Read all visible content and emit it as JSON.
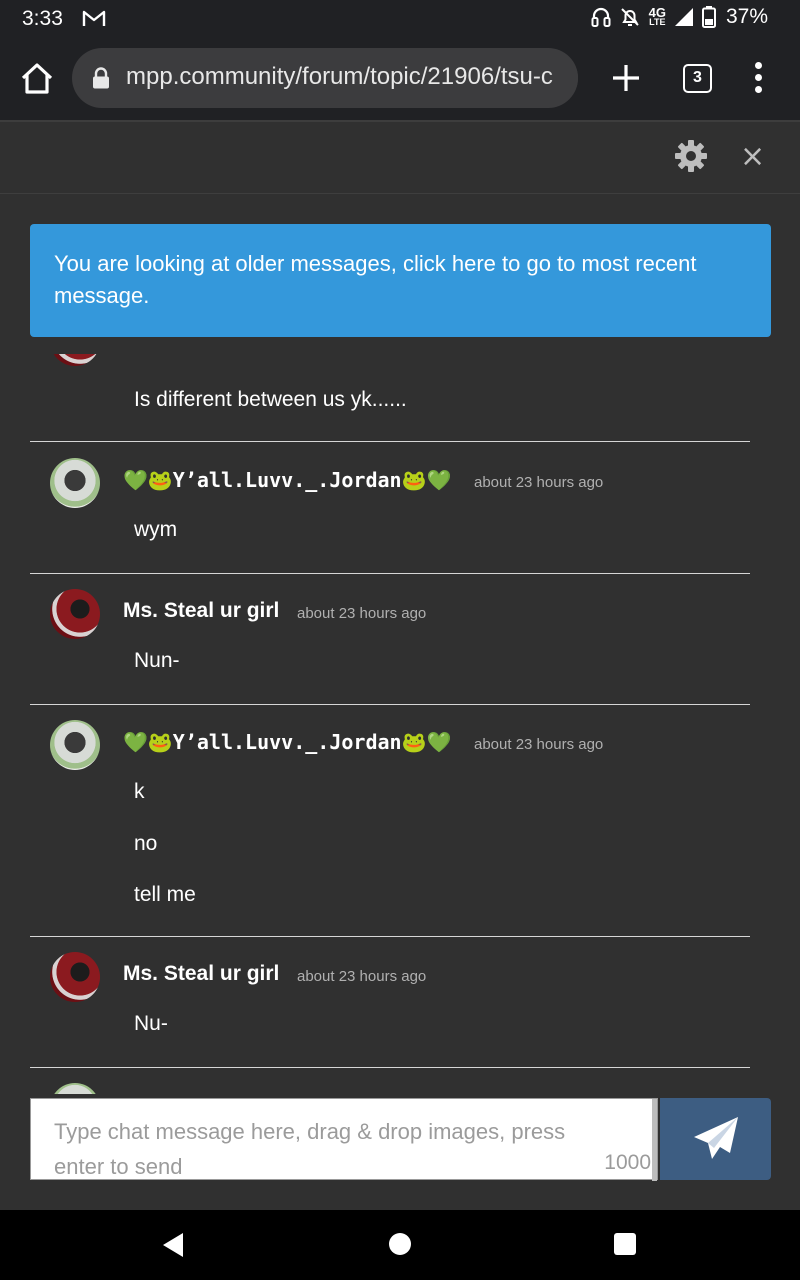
{
  "status_bar": {
    "time": "3:33",
    "network": "4G",
    "network_sub": "LTE",
    "battery": "37%",
    "icons": [
      "gmail-icon",
      "headphones-icon",
      "bell-off-icon",
      "signal-icon",
      "battery-icon"
    ]
  },
  "browser": {
    "url": "mpp.community/forum/topic/21906/tsu-c",
    "tab_count": "3",
    "icons": [
      "home-icon",
      "lock-icon",
      "plus-icon",
      "overflow-menu-icon"
    ]
  },
  "chat": {
    "header_icons": [
      "gear-icon",
      "close-icon"
    ],
    "close_glyph": "×",
    "notice": "You are looking at older messages, click here to go to most recent message.",
    "messages": [
      {
        "user": "",
        "time": "",
        "lines": [
          "Is different between us yk......"
        ]
      },
      {
        "user": "💚🐸Y’all.Luvv._.Jordan🐸💚",
        "time": "about 23 hours ago",
        "lines": [
          "wym"
        ]
      },
      {
        "user": "Ms. Steal ur girl",
        "time": "about 23 hours ago",
        "lines": [
          "Nun-"
        ]
      },
      {
        "user": "💚🐸Y’all.Luvv._.Jordan🐸💚",
        "time": "about 23 hours ago",
        "lines": [
          "k",
          "no",
          "tell me"
        ]
      },
      {
        "user": "Ms. Steal ur girl",
        "time": "about 23 hours ago",
        "lines": [
          "Nu-"
        ]
      }
    ],
    "composer": {
      "placeholder": "Type chat message here, drag & drop images, press enter to send",
      "char_count": "1000"
    },
    "colors": {
      "notice_bg": "#3498db",
      "send_bg": "#3d5d82",
      "panel_bg": "#303030"
    }
  },
  "nav": {
    "icons": [
      "back-icon",
      "home-circle-icon",
      "recents-icon"
    ]
  }
}
